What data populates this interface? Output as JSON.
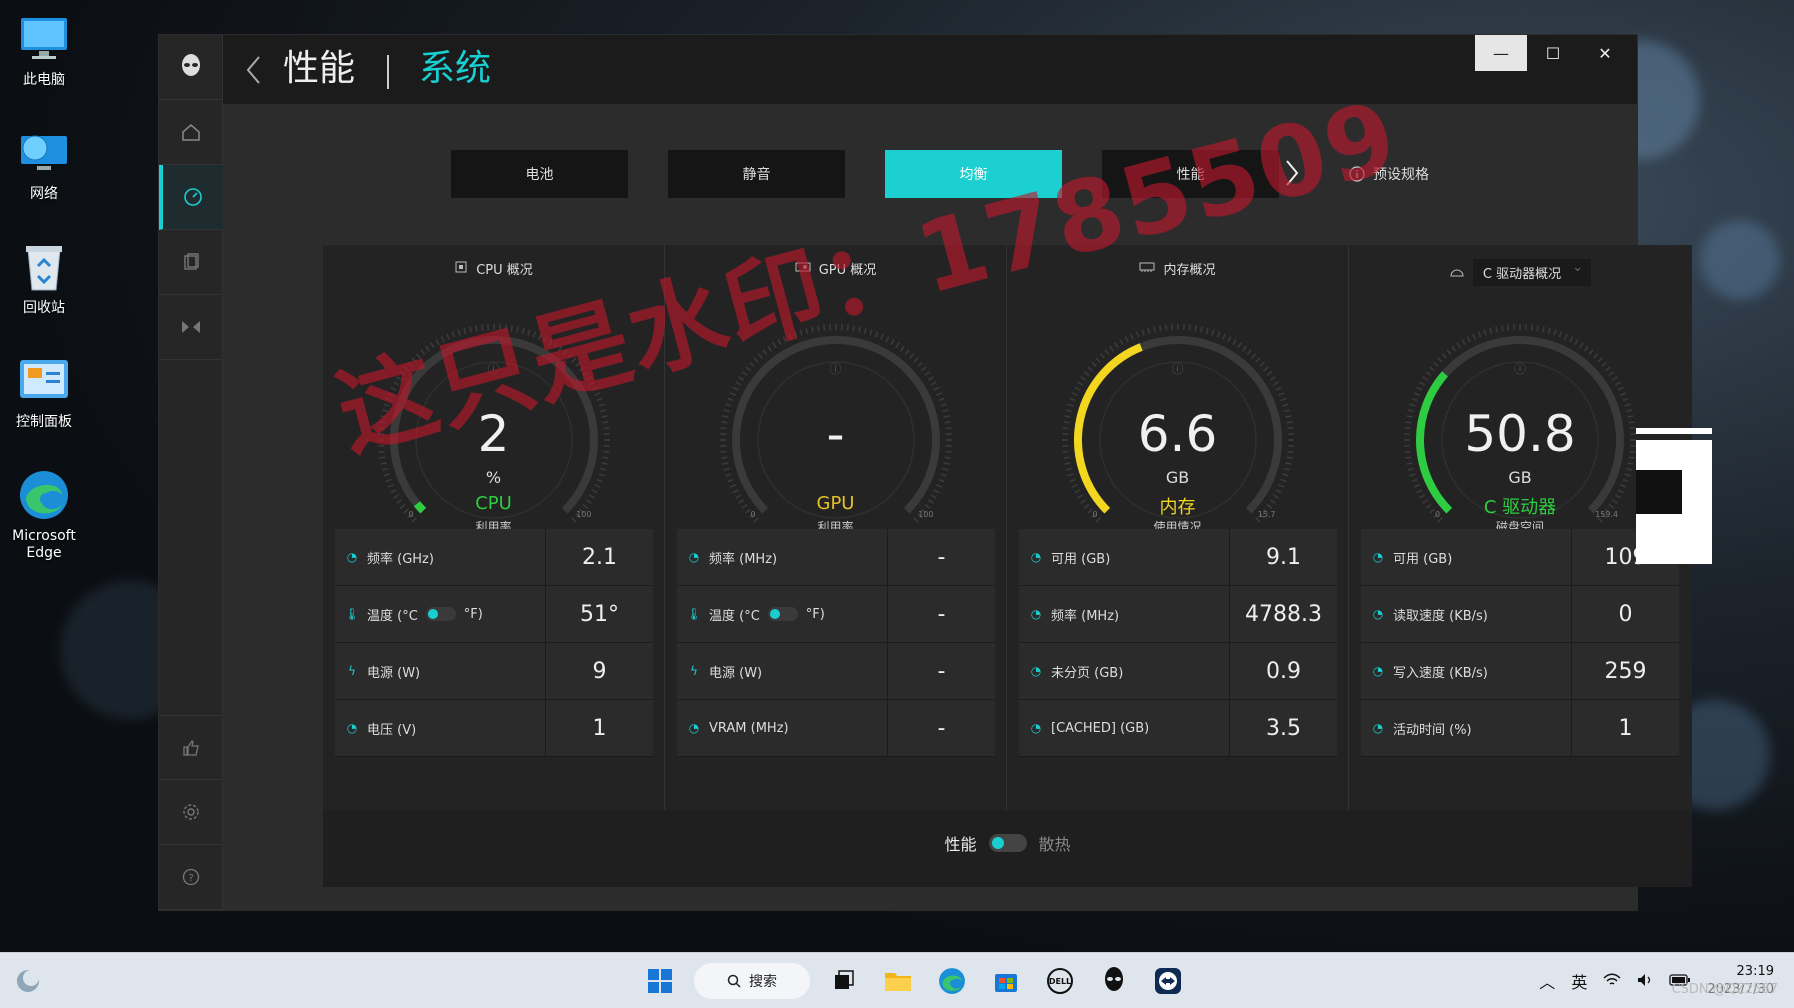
{
  "desktop": {
    "icons": [
      {
        "label": "此电脑",
        "icon": "monitor-icon"
      },
      {
        "label": "网络",
        "icon": "network-icon"
      },
      {
        "label": "回收站",
        "icon": "recycle-bin-icon"
      },
      {
        "label": "控制面板",
        "icon": "control-panel-icon"
      },
      {
        "label": "Microsoft Edge",
        "icon": "edge-icon"
      }
    ]
  },
  "window": {
    "title": "性能",
    "subtitle": "系统",
    "accent": "#19cfd1"
  },
  "modes": {
    "buttons": [
      "电池",
      "静音",
      "均衡",
      "性能"
    ],
    "active": "均衡",
    "preset_label": "预设规格"
  },
  "panels": [
    {
      "header": "CPU 概况",
      "gauge": {
        "value": "2",
        "unit": "%",
        "name": "CPU",
        "sub": "利用率",
        "min": "0",
        "max": "100",
        "fraction": 0.02,
        "name_color": "#2ecc40"
      },
      "rows": [
        {
          "label": "频率 (GHz)",
          "value": "2.1"
        },
        {
          "label_a": "温度 (°C",
          "label_b": "°F)",
          "value": "51°"
        },
        {
          "label": "电源 (W)",
          "value": "9"
        },
        {
          "label": "电压 (V)",
          "value": "1"
        }
      ]
    },
    {
      "header": "GPU 概况",
      "gauge": {
        "value": "-",
        "unit": "",
        "name": "GPU",
        "sub": "利用率",
        "min": "0",
        "max": "100",
        "fraction": 0,
        "name_color": "#e6c229"
      },
      "rows": [
        {
          "label": "频率 (MHz)",
          "value": "-"
        },
        {
          "label_a": "温度 (°C",
          "label_b": "°F)",
          "value": "-"
        },
        {
          "label": "电源 (W)",
          "value": "-"
        },
        {
          "label": "VRAM (MHz)",
          "value": "-"
        }
      ]
    },
    {
      "header": "内存概况",
      "gauge": {
        "value": "6.6",
        "unit": "GB",
        "name": "内存",
        "sub": "使用情况",
        "min": "0",
        "max": "15.7",
        "fraction": 0.42,
        "name_color": "#f2d61f"
      },
      "rows": [
        {
          "label": "可用 (GB)",
          "value": "9.1"
        },
        {
          "label": "频率 (MHz)",
          "value": "4788.3"
        },
        {
          "label": "未分页 (GB)",
          "value": "0.9"
        },
        {
          "label": "[CACHED] (GB)",
          "value": "3.5"
        }
      ]
    },
    {
      "header": "C 驱动器概况",
      "gauge": {
        "value": "50.8",
        "unit": "GB",
        "name": "C  驱动器",
        "sub": "磁盘空间",
        "min": "0",
        "max": "159.4",
        "fraction": 0.32,
        "name_color": "#2ecc40"
      },
      "rows": [
        {
          "label": "可用 (GB)",
          "value": "109"
        },
        {
          "label": "读取速度 (KB/s)",
          "value": "0"
        },
        {
          "label": "写入速度 (KB/s)",
          "value": "259"
        },
        {
          "label": "活动时间 (%)",
          "value": "1"
        }
      ]
    }
  ],
  "bottom_toggle": {
    "left": "性能",
    "right": "散热"
  },
  "watermark": "这只是水印：1785509",
  "taskbar": {
    "search_label": "搜索",
    "ime": "英",
    "time": "23:19",
    "date": "2023/7/30"
  },
  "corner_credit": "CSDN @QZ2587"
}
